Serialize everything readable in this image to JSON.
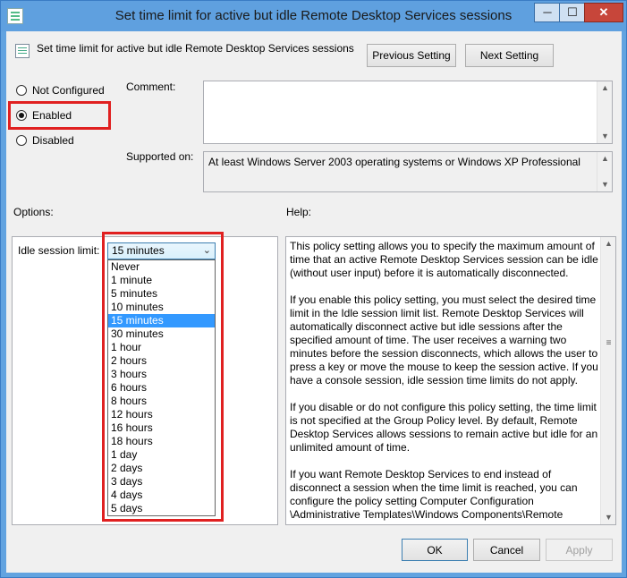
{
  "window": {
    "title": "Set time limit for active but idle Remote Desktop Services sessions",
    "min_glyph": "─",
    "max_glyph": "☐",
    "close_glyph": "✕"
  },
  "header": {
    "setting_name": "Set time limit for active but idle Remote Desktop Services sessions",
    "previous_label": "Previous Setting",
    "next_label": "Next Setting"
  },
  "state": {
    "options": [
      "Not Configured",
      "Enabled",
      "Disabled"
    ],
    "selected": "Enabled"
  },
  "comment": {
    "label": "Comment:",
    "value": ""
  },
  "supported": {
    "label": "Supported on:",
    "value": "At least Windows Server 2003 operating systems or Windows XP Professional"
  },
  "options_panel": {
    "label": "Options:",
    "idle_label": "Idle session limit:",
    "selected": "15 minutes",
    "items": [
      "Never",
      "1 minute",
      "5 minutes",
      "10 minutes",
      "15 minutes",
      "30 minutes",
      "1 hour",
      "2 hours",
      "3 hours",
      "6 hours",
      "8 hours",
      "12 hours",
      "16 hours",
      "18 hours",
      "1 day",
      "2 days",
      "3 days",
      "4 days",
      "5 days"
    ]
  },
  "help_panel": {
    "label": "Help:",
    "paragraphs": [
      "This policy setting allows you to specify the maximum amount of time that an active Remote Desktop Services session can be idle (without user input) before it is automatically disconnected.",
      "If you enable this policy setting, you must select the desired time limit in the Idle session limit list. Remote Desktop Services will automatically disconnect active but idle sessions after the specified amount of time. The user receives a warning two minutes before the session disconnects, which allows the user to press a key or move the mouse to keep the session active. If you have a console session, idle session time limits do not apply.",
      "If you disable or do not configure this policy setting, the time limit is not specified at the Group Policy level. By default, Remote Desktop Services allows sessions to remain active but idle for an unlimited amount of time.",
      "If you want Remote Desktop Services to end instead of disconnect a session when the time limit is reached, you can configure the policy setting Computer Configuration \\Administrative Templates\\Windows Components\\Remote"
    ]
  },
  "footer": {
    "ok": "OK",
    "cancel": "Cancel",
    "apply": "Apply"
  },
  "colors": {
    "highlight_box": "#e02020",
    "selected_item": "#3399ff"
  }
}
